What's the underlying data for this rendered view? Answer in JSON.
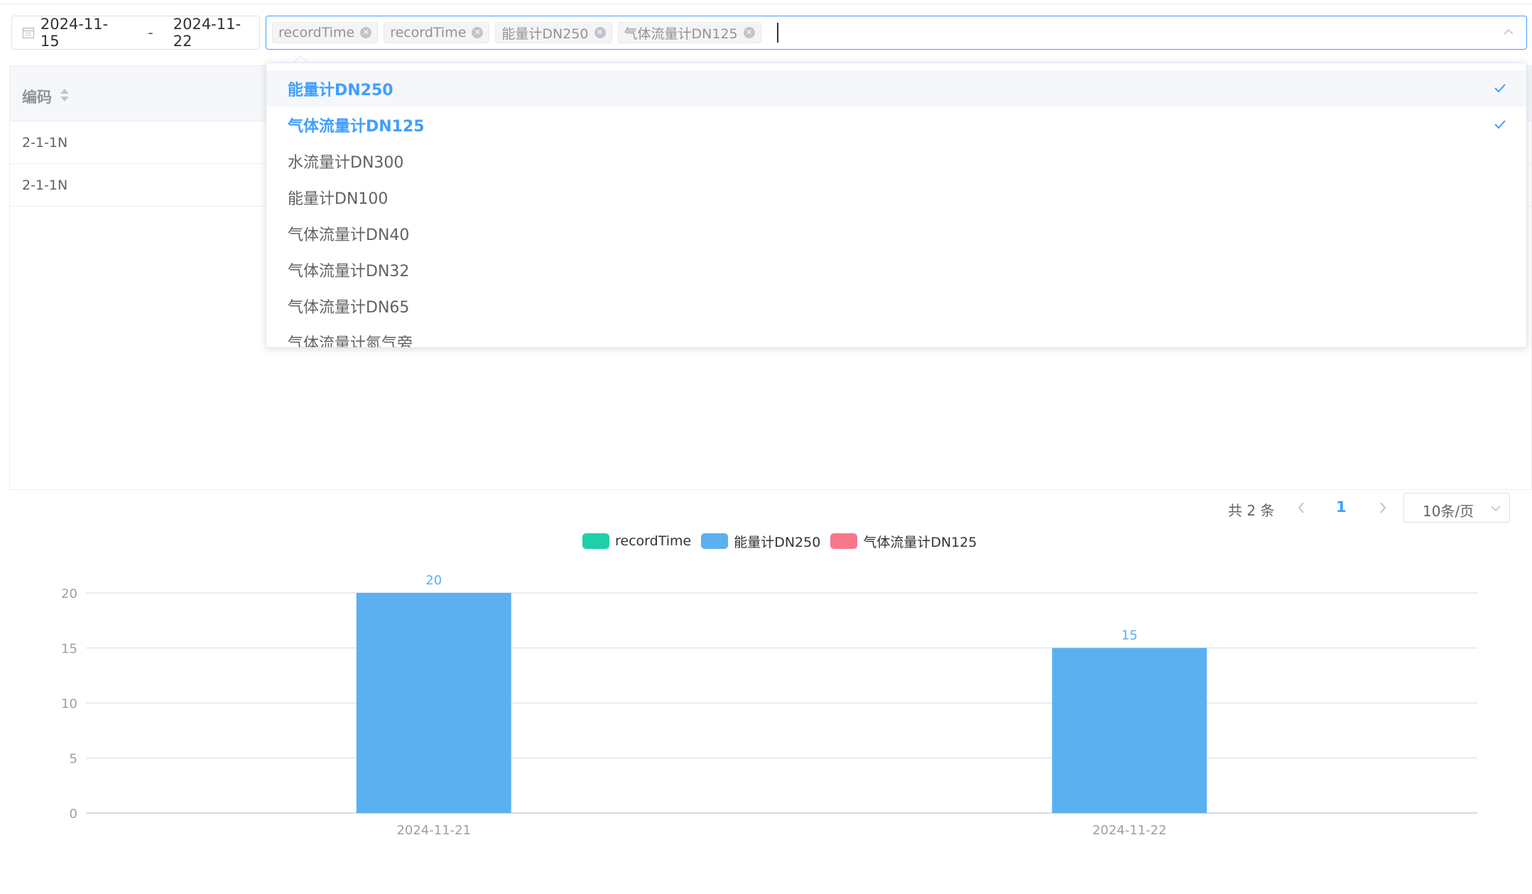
{
  "filters": {
    "date_start": "2024-11-15",
    "date_separator": "-",
    "date_end": "2024-11-22",
    "selected_tags": [
      "recordTime",
      "recordTime",
      "能量计DN250",
      "气体流量计DN125"
    ]
  },
  "table": {
    "column_header": "编码",
    "rows": [
      "2-1-1N",
      "2-1-1N"
    ]
  },
  "dropdown": {
    "options": [
      {
        "label": "能量计DN250",
        "selected": true
      },
      {
        "label": "气体流量计DN125",
        "selected": true
      },
      {
        "label": "水流量计DN300",
        "selected": false
      },
      {
        "label": "能量计DN100",
        "selected": false
      },
      {
        "label": "气体流量计DN40",
        "selected": false
      },
      {
        "label": "气体流量计DN32",
        "selected": false
      },
      {
        "label": "气体流量计DN65",
        "selected": false
      },
      {
        "label": "气体流量计氮气旁",
        "selected": false
      }
    ]
  },
  "pagination": {
    "total": "共 2 条",
    "current_page": "1",
    "page_size": "10条/页"
  },
  "colors": {
    "accent": "#409eff",
    "recordTime": "#1fd0a7",
    "dn250": "#5bb0f0",
    "dn125": "#f8778a"
  },
  "chart_data": {
    "type": "bar",
    "categories": [
      "2024-11-21",
      "2024-11-22"
    ],
    "series": [
      {
        "name": "recordTime",
        "values": [
          null,
          null
        ]
      },
      {
        "name": "能量计DN250",
        "values": [
          20,
          15
        ]
      },
      {
        "name": "气体流量计DN125",
        "values": [
          null,
          null
        ]
      }
    ],
    "legend": [
      "recordTime",
      "能量计DN250",
      "气体流量计DN125"
    ],
    "legend_position": "top-center",
    "y_ticks": [
      "0",
      "5",
      "10",
      "15",
      "20"
    ],
    "ylim": [
      0,
      20
    ],
    "grid": true,
    "data_labels": [
      "20",
      "15"
    ]
  }
}
